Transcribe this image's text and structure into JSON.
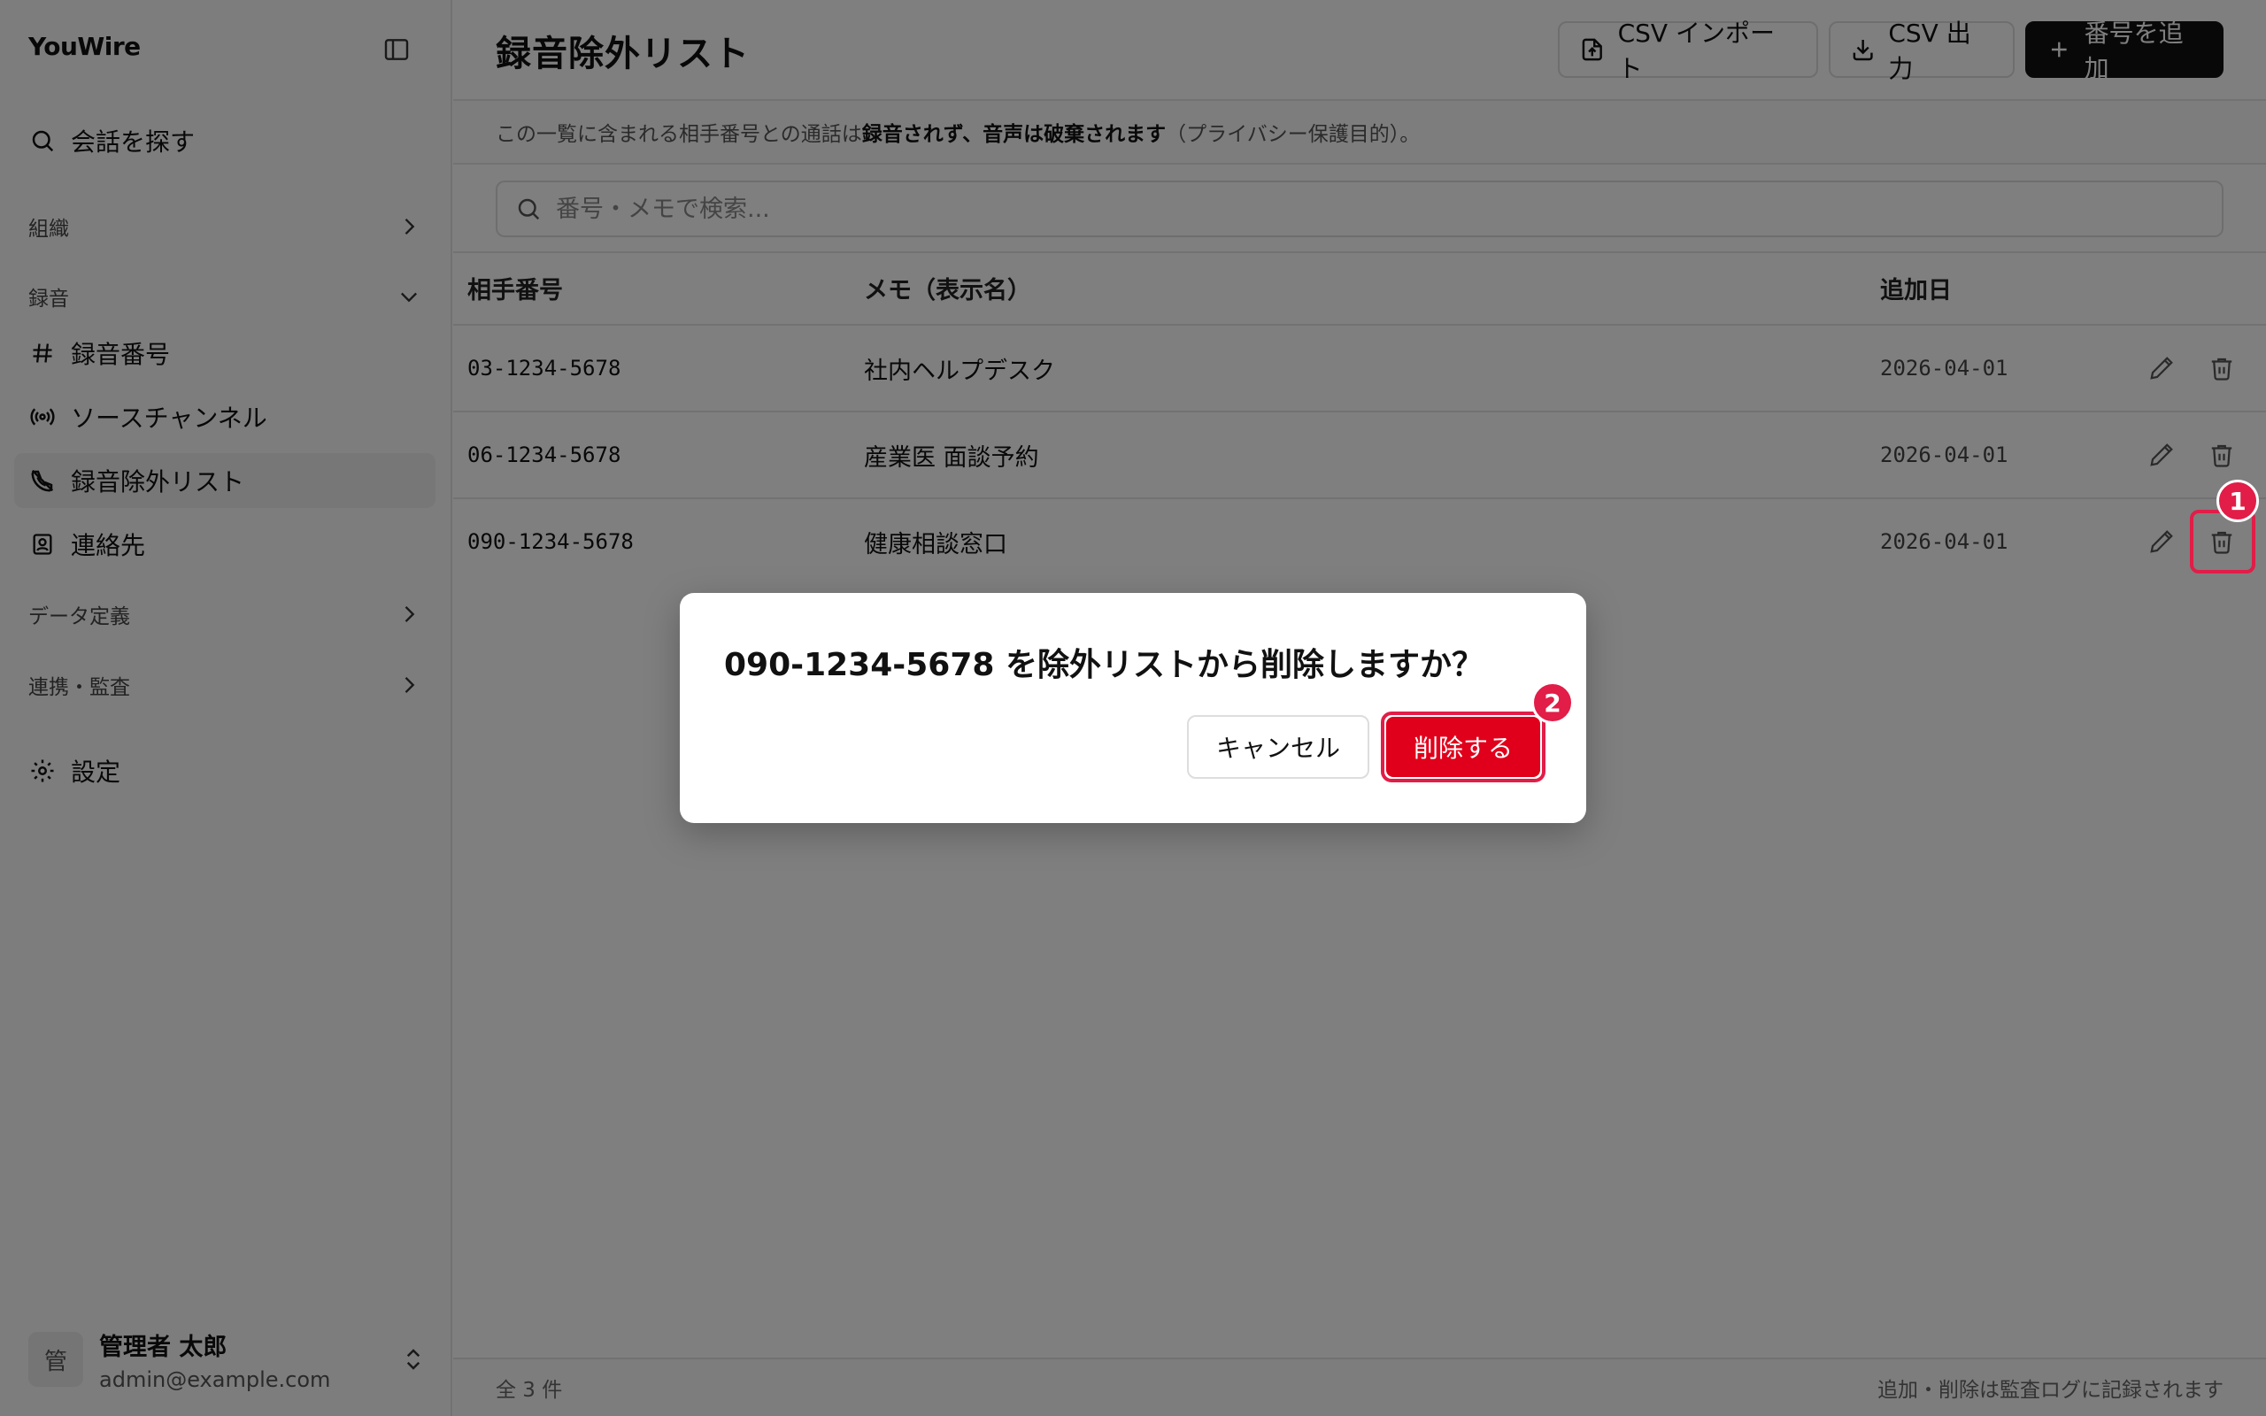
{
  "sidebar": {
    "brand": "YouWire",
    "search_label": "会話を探す",
    "sections": {
      "org": "組織",
      "recording": "録音",
      "data_def": "データ定義",
      "integration": "連携・監査"
    },
    "recording_items": [
      {
        "label": "録音番号",
        "icon": "hash-icon"
      },
      {
        "label": "ソースチャンネル",
        "icon": "broadcast-icon"
      },
      {
        "label": "録音除外リスト",
        "icon": "phone-off-icon",
        "active": true
      },
      {
        "label": "連絡先",
        "icon": "contact-icon"
      }
    ],
    "settings_label": "設定",
    "user": {
      "avatar": "管",
      "name": "管理者 太郎",
      "email": "admin@example.com"
    }
  },
  "header": {
    "title": "録音除外リスト",
    "import_label": "CSV インポート",
    "export_label": "CSV 出力",
    "add_label": "番号を追加"
  },
  "notice": {
    "prefix": "この一覧に含まれる相手番号との通話は",
    "emphasis": "録音されず、音声は破棄されます",
    "suffix": "（プライバシー保護目的）。"
  },
  "search": {
    "placeholder": "番号・メモで検索..."
  },
  "table": {
    "columns": {
      "number": "相手番号",
      "memo": "メモ（表示名）",
      "date": "追加日"
    },
    "rows": [
      {
        "number": "03-1234-5678",
        "memo": "社内ヘルプデスク",
        "date": "2026-04-01"
      },
      {
        "number": "06-1234-5678",
        "memo": "産業医 面談予約",
        "date": "2026-04-01"
      },
      {
        "number": "090-1234-5678",
        "memo": "健康相談窓口",
        "date": "2026-04-01"
      }
    ]
  },
  "footer": {
    "count": "全 3 件",
    "note": "追加・削除は監査ログに記録されます"
  },
  "dialog": {
    "title": "090-1234-5678 を除外リストから削除しますか？",
    "cancel_label": "キャンセル",
    "delete_label": "削除する"
  },
  "annotations": {
    "badge1": "1",
    "badge2": "2"
  },
  "colors": {
    "danger": "#e0001b",
    "highlight": "#e11d48",
    "primary": "#111111"
  }
}
